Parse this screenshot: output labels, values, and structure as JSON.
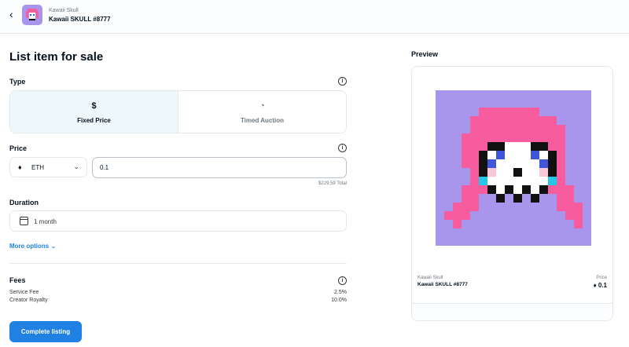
{
  "header": {
    "back_icon": "chevron-left-icon",
    "collection_name": "Kawaii Skull",
    "item_name": "Kawaii SKULL #8777"
  },
  "form": {
    "title": "List item for sale",
    "type_label": "Type",
    "type_options": [
      {
        "label": "Fixed Price",
        "icon": "$",
        "selected": true
      },
      {
        "label": "Timed Auction",
        "icon": "◔",
        "selected": false
      }
    ],
    "price_label": "Price",
    "currency": "ETH",
    "price_value": "0.1",
    "usd_total": "$229.59 Total",
    "duration_label": "Duration",
    "duration_value": "1 month",
    "more_options": "More options",
    "fees_label": "Fees",
    "fees": [
      {
        "name": "Service Fee",
        "value": "2.5%"
      },
      {
        "name": "Creator Royalty",
        "value": "10.0%"
      }
    ],
    "submit_label": "Complete listing"
  },
  "preview": {
    "title": "Preview",
    "collection_name": "Kawaii Skull",
    "item_name": "Kawaii SKULL #8777",
    "price_label": "Price",
    "price_value": "0.1"
  },
  "colors": {
    "accent": "#2081e2",
    "art_background": "#a896ec",
    "hair": "#f75d9e",
    "selected_option_bg": "#eef7fc"
  }
}
